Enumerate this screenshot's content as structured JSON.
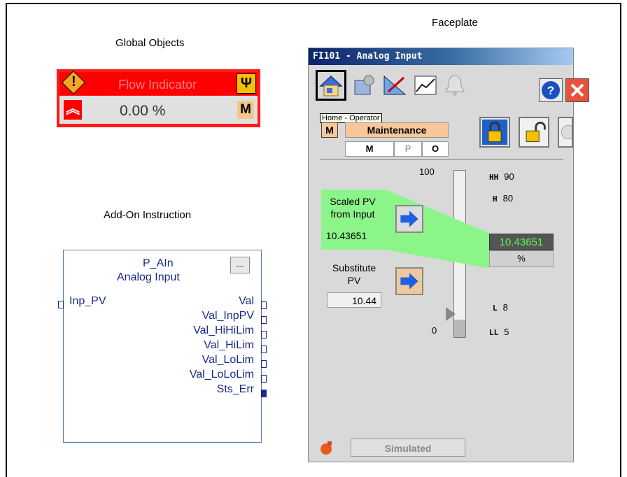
{
  "labels": {
    "global_objects": "Global Objects",
    "faceplate": "Faceplate",
    "add_on_instruction": "Add-On Instruction"
  },
  "global_object": {
    "title": "Flow Indicator",
    "value": "0.00 %",
    "mode": "M",
    "icons": [
      "alarm-diamond-icon",
      "maintenance-wrench-icon",
      "high-chevron-icon"
    ],
    "accent_color": "#ff0000"
  },
  "aoi": {
    "name": "P_AIn",
    "description": "Analog Input",
    "dots": "...",
    "input": "Inp_PV",
    "outputs": [
      "Val",
      "Val_InpPV",
      "Val_HiHiLim",
      "Val_HiLim",
      "Val_LoLim",
      "Val_LoLoLim",
      "Sts_Err"
    ]
  },
  "faceplate": {
    "title": "FI101 - Analog Input",
    "tooltip": "Home - Operator",
    "mode_m": "M",
    "mode_text": "Maintenance",
    "mode_row": [
      "M",
      "P",
      "O"
    ],
    "scale_top": "100",
    "scale_bottom": "0",
    "limits": {
      "hh_key": "HH",
      "hh_val": "90",
      "h_key": "H",
      "h_val": "80",
      "l_key": "L",
      "l_val": "8",
      "ll_key": "LL",
      "ll_val": "5"
    },
    "pv_label_1": "Scaled PV",
    "pv_label_2": "from Input",
    "pv_value": "10.43651",
    "sub_label_1": "Substitute",
    "sub_label_2": "PV",
    "sub_value": "10.44",
    "out_value": "10.43651",
    "out_unit": "%",
    "status": "Simulated",
    "pv_level_percent": 10.4
  }
}
